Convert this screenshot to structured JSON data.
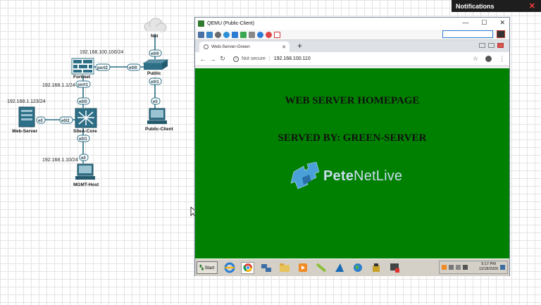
{
  "topology": {
    "nodes": {
      "net": "Net",
      "fortinet": "Fortinet",
      "public": "Public",
      "web_server": "Web-Server",
      "sitea_core": "SiteA-Core",
      "public_client": "Public-Client",
      "mgmt_host": "MGMT-Host"
    },
    "ips": {
      "fortinet_wan": "192.168.100.100/24",
      "fortinet_lan": "192.168.1.1/24",
      "web_server": "192.168.1.123/24",
      "mgmt_host": "192.168.1.10/24"
    },
    "interfaces": {
      "net_e0_0": "e0/0",
      "fortinet_port2": "port2",
      "public_e0_0": "e0/0",
      "public_e0_1": "e0/1",
      "public_client_e0": "e0",
      "fortinet_port1": "port1",
      "core_e0_0": "e0/0",
      "core_e0_2": "e0/2",
      "web_server_e0": "e0",
      "core_e0_1": "e0/1",
      "mgmt_e0": "e0"
    }
  },
  "notifications": {
    "title": "Notifications",
    "close": "✕"
  },
  "qemu": {
    "title": "QEMU (Public-Client)",
    "minimize": "—",
    "maximize": "☐",
    "close": "✕"
  },
  "browser": {
    "tab_title": "Web-Server-Green",
    "tab_close": "✕",
    "new_tab": "+",
    "not_secure": "Not secure",
    "url": "192.168.100.110",
    "back": "←",
    "forward": "→",
    "reload": "↻",
    "star": "☆",
    "menu": "⋮"
  },
  "page": {
    "heading": "WEB SERVER HOMEPAGE",
    "subheading": "SERVED BY: GREEN-SERVER",
    "logo_bold": "Pete",
    "logo_rest": "NetLive"
  },
  "taskbar": {
    "start": "Start",
    "time": "5:17 PM",
    "date": "11/18/2020"
  },
  "colors": {
    "page_bg": "#008000",
    "link": "#2d6f86",
    "logo_text": "#c9ddf0"
  }
}
